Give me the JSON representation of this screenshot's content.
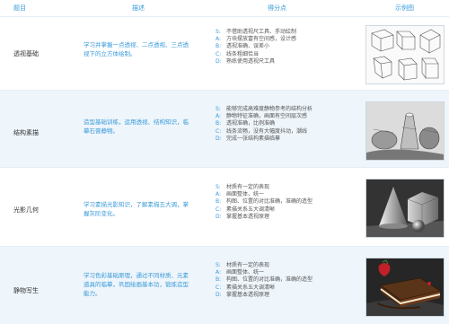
{
  "headers": {
    "topic": "题目",
    "desc": "描述",
    "points": "得分点",
    "example": "示例图"
  },
  "rows": [
    {
      "title": "透视基础",
      "desc": "学习并掌握一点透视、二点透视、三点透视下的立方体绘制。",
      "points": [
        {
          "k": "S:",
          "t": "不借助透视尺工具、手动绘制"
        },
        {
          "k": "A:",
          "t": "方块摆放富有空间感，设计感"
        },
        {
          "k": "B:",
          "t": "透视准确、误差小"
        },
        {
          "k": "C:",
          "t": "线条粗细恰当"
        },
        {
          "k": "D:",
          "t": "熟练使用透视尺工具"
        }
      ],
      "image": "perspective-cubes"
    },
    {
      "title": "结构素描",
      "desc": "造型基础训练，运用透视、结构知识，临摹石膏静物。",
      "points": [
        {
          "k": "S:",
          "t": "能够完成高难度静物参考的结构分析"
        },
        {
          "k": "A:",
          "t": "静物特征准确，画面有空间层次感"
        },
        {
          "k": "B:",
          "t": "透视准确，比例准确"
        },
        {
          "k": "C:",
          "t": "线条流畅，没有大幅度抖动，潮线"
        },
        {
          "k": "D:",
          "t": "完成一张结构素描临摹"
        }
      ],
      "image": "structure-sketch"
    },
    {
      "title": "光影几何",
      "desc": "学习素描光影知识，了解素描五大调，掌握灰阶变化。",
      "points": [
        {
          "k": "S:",
          "t": "材质有一定的表现"
        },
        {
          "k": "A:",
          "t": "画面整体、统一"
        },
        {
          "k": "B:",
          "t": "构图、位置的对比准确，准确的造型"
        },
        {
          "k": "C:",
          "t": "素描关系五大调清晰"
        },
        {
          "k": "D:",
          "t": "掌握基本透视原理"
        }
      ],
      "image": "light-geometry"
    },
    {
      "title": "静物写生",
      "desc": "学习色彩基础原理，通过不同材质、元素道具的临摹，巩固绘画基本功，锻炼造型能力。",
      "points": [
        {
          "k": "S:",
          "t": "材质有一定的表现"
        },
        {
          "k": "A:",
          "t": "画面整体、统一"
        },
        {
          "k": "B:",
          "t": "构图、位置的对比准确，准确的造型"
        },
        {
          "k": "C:",
          "t": "素描关系五大调清晰"
        },
        {
          "k": "D:",
          "t": "掌握基本透视原理"
        }
      ],
      "image": "still-life-cake"
    }
  ]
}
